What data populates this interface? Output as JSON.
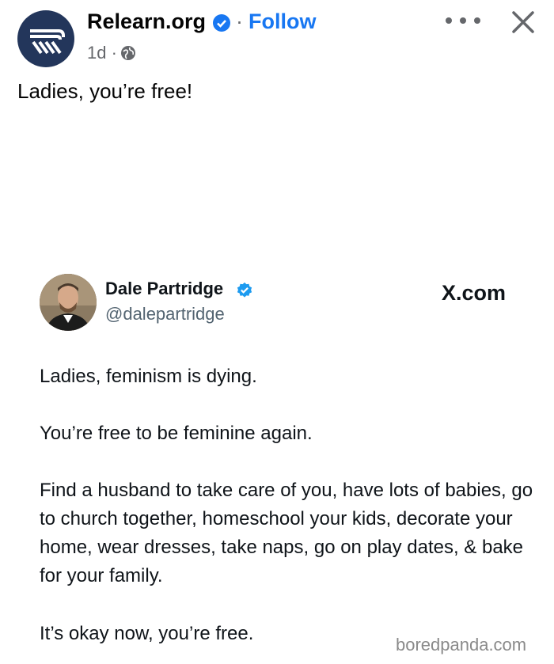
{
  "post": {
    "page_name": "Relearn.org",
    "separator": "·",
    "follow_label": "Follow",
    "time": "1d ·",
    "text": "Ladies, you’re free!"
  },
  "icons": {
    "verified": "verified-badge-icon",
    "globe": "globe-icon",
    "more": "more-options-icon",
    "close": "close-icon"
  },
  "tweet": {
    "name": "Dale Partridge",
    "handle": "@dalepartridge",
    "source": "X.com",
    "paragraphs": [
      "Ladies, feminism is dying.",
      "You’re free to be feminine again.",
      "Find a husband to take care of you, have lots of babies, go to church together, homeschool your kids, decorate your home, wear dresses, take naps, go on play dates, & bake for your family.",
      "It’s okay now, you’re free."
    ]
  },
  "watermark": "boredpanda.com",
  "colors": {
    "brand_blue": "#1877f2",
    "page_avatar_bg": "#23365b",
    "meta_gray": "#65676b",
    "handle_gray": "#536471"
  }
}
